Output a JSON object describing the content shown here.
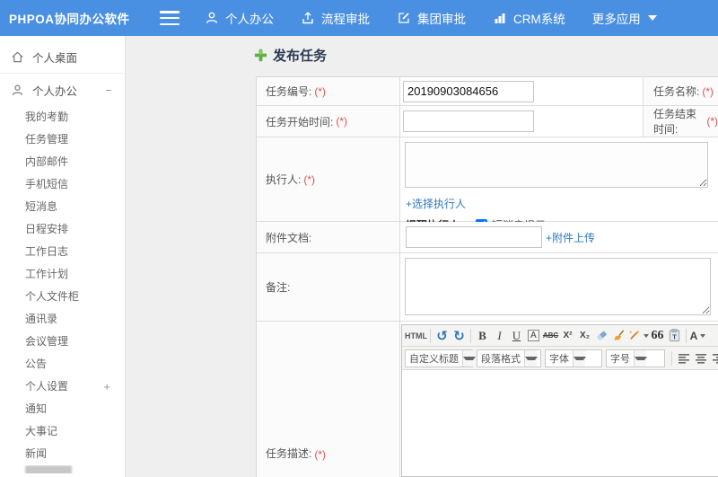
{
  "colors": {
    "header_bg": "#4a90e2",
    "link_blue": "#2d7ac4",
    "required_red": "#e4504f",
    "title_dark": "#2b3b52",
    "plus_green": "#5fb13f"
  },
  "header": {
    "logo": "PHPOA协同办公软件",
    "menu": [
      {
        "label": "个人办公",
        "icon": "user-icon"
      },
      {
        "label": "流程审批",
        "icon": "approval-upload-icon"
      },
      {
        "label": "集团审批",
        "icon": "edit-square-icon"
      },
      {
        "label": "CRM系统",
        "icon": "bar-chart-icon"
      },
      {
        "label": "更多应用",
        "icon": "caret-down-icon"
      }
    ]
  },
  "sidebar": {
    "desktop_label": "个人桌面",
    "section": {
      "label": "个人办公",
      "toggle": "−"
    },
    "items": [
      {
        "label": "我的考勤"
      },
      {
        "label": "任务管理"
      },
      {
        "label": "内部邮件"
      },
      {
        "label": "手机短信"
      },
      {
        "label": "短消息"
      },
      {
        "label": "日程安排"
      },
      {
        "label": "工作日志"
      },
      {
        "label": "工作计划"
      },
      {
        "label": "个人文件柜"
      },
      {
        "label": "通讯录"
      },
      {
        "label": "会议管理"
      },
      {
        "label": "公告"
      },
      {
        "label": "个人设置",
        "toggle": "+"
      },
      {
        "label": "通知"
      },
      {
        "label": "大事记"
      },
      {
        "label": "新闻"
      }
    ]
  },
  "main": {
    "title": "发布任务",
    "form": {
      "required_mark": "(*)",
      "task_no_label": "任务编号:",
      "task_no_value": "20190903084656",
      "task_name_label": "任务名称:",
      "start_label": "任务开始时间:",
      "end_label": "任务结束时间:",
      "executor_label": "执行人:",
      "choose_executor_link": "+选择执行人",
      "remind_label": "提醒执行人:",
      "sms_label": "短消息提示",
      "sms_checked": "checked",
      "attach_label": "附件文档:",
      "attach_upload_link": "+附件上传",
      "remark_label": "备注:",
      "desc_label": "任务描述:"
    },
    "editor": {
      "html_btn": "HTML",
      "undo": "↺",
      "redo": "↻",
      "bold": "B",
      "italic": "I",
      "underline": "U",
      "font_bg": "A",
      "strike": "ABC",
      "superscript": "X²",
      "subscript": "X₂",
      "quote": "66",
      "forecolor": "A",
      "dropdowns": [
        {
          "label": "自定义标题"
        },
        {
          "label": "段落格式"
        },
        {
          "label": "字体"
        },
        {
          "label": "字号"
        }
      ]
    }
  }
}
